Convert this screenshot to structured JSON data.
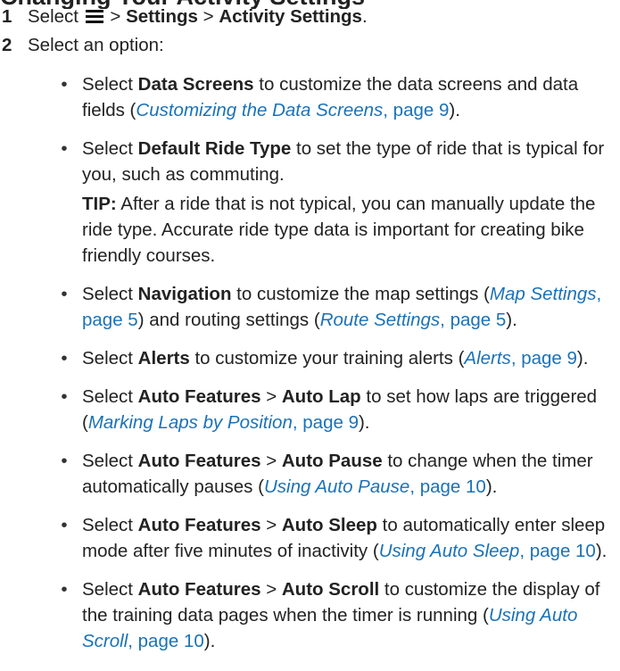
{
  "heading": "Changing Your Activity Settings",
  "step1": {
    "num": "1",
    "select": "Select",
    "menu_icon": "menu-icon",
    "sep1": ">",
    "settings": "Settings",
    "sep2": ">",
    "activity_settings": "Activity Settings",
    "period": "."
  },
  "step2": {
    "num": "2",
    "text": "Select an option:"
  },
  "bullet_marker": "•",
  "b1": {
    "pre": "Select ",
    "bold": "Data Screens",
    "mid": " to customize the data screens and data fields (",
    "link": "Customizing the Data Screens",
    "page": ", page 9",
    "end": ")."
  },
  "b2": {
    "pre": "Select ",
    "bold": "Default Ride Type",
    "post": " to set the type of ride that is typical for you, such as commuting."
  },
  "tip": {
    "label": "TIP:",
    "text": " After a ride that is not typical, you can manually update the ride type. Accurate ride type data is important for creating bike friendly courses."
  },
  "b3": {
    "pre": "Select ",
    "bold": "Navigation",
    "mid1": " to customize the map settings (",
    "link1": "Map Settings",
    "page1": ", page 5",
    "mid2": ") and routing settings (",
    "link2": "Route Settings",
    "page2": ", page 5",
    "end": ")."
  },
  "b4": {
    "pre": "Select ",
    "bold": "Alerts",
    "mid": " to customize your training alerts (",
    "link": "Alerts",
    "page": ", page 9",
    "end": ")."
  },
  "b5": {
    "pre": "Select ",
    "bold1": "Auto Features",
    "sep": " > ",
    "bold2": "Auto Lap",
    "mid": " to set how laps are triggered (",
    "link": "Marking Laps by Position",
    "page": ", page 9",
    "end": ")."
  },
  "b6": {
    "pre": "Select ",
    "bold1": "Auto Features",
    "sep": " > ",
    "bold2": "Auto Pause",
    "mid": " to change when the timer automatically pauses (",
    "link": "Using Auto Pause",
    "page": ", page 10",
    "end": ")."
  },
  "b7": {
    "pre": "Select ",
    "bold1": "Auto Features",
    "sep": " > ",
    "bold2": "Auto Sleep",
    "mid": " to automatically enter sleep mode after five minutes of inactivity (",
    "link": "Using Auto Sleep",
    "page": ", page 10",
    "end": ")."
  },
  "b8": {
    "pre": "Select ",
    "bold1": "Auto Features",
    "sep": " > ",
    "bold2": "Auto Scroll",
    "mid": " to customize the display of the training data pages when the timer is running (",
    "link": "Using Auto Scroll",
    "page": ", page 10",
    "end": ")."
  }
}
